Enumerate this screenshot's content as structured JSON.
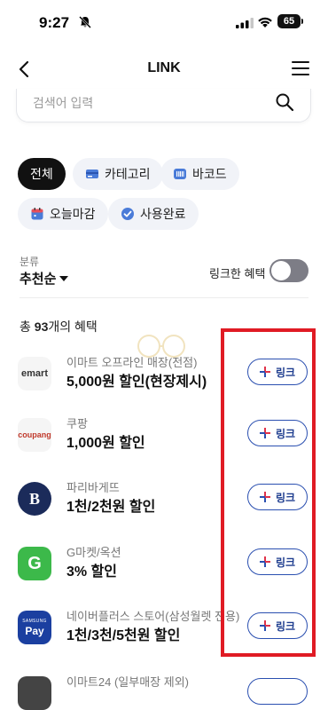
{
  "status_bar": {
    "time": "9:27",
    "battery": "65"
  },
  "header": {
    "title": "LINK"
  },
  "search": {
    "placeholder": "검색어 입력"
  },
  "filters": [
    {
      "label": "전체",
      "icon": "none",
      "active": true
    },
    {
      "label": "카테고리",
      "icon": "card-icon",
      "active": false
    },
    {
      "label": "바코드",
      "icon": "barcode-icon",
      "active": false
    },
    {
      "label": "오늘마감",
      "icon": "calendar-icon",
      "active": false
    },
    {
      "label": "사용완료",
      "icon": "check-circle-icon",
      "active": false
    }
  ],
  "sort": {
    "caption": "분류",
    "value": "추천순"
  },
  "linked_toggle": {
    "label": "링크한 혜택",
    "on": false
  },
  "summary": {
    "prefix": "총 ",
    "count": "93",
    "suffix": "개의 혜택"
  },
  "link_label": "링크",
  "items": [
    {
      "brand": "이마트 오프라인 매장(전점)",
      "benefit": "5,000원 할인(현장제시)",
      "logo_text": "emart"
    },
    {
      "brand": "쿠팡",
      "benefit": "1,000원 할인",
      "logo_text": "coupang"
    },
    {
      "brand": "파리바게뜨",
      "benefit": "1천/2천원 할인",
      "logo_text": "B"
    },
    {
      "brand": "G마켓/옥션",
      "benefit": "3% 할인",
      "logo_text": "G"
    },
    {
      "brand": "네이버플러스 스토어(삼성월렛 전용)",
      "benefit": "1천/3천/5천원 할인",
      "logo_text": "Pay",
      "logo_subtext": "SAMSUNG"
    },
    {
      "brand": "이마트24 (일부매장 제외)",
      "benefit": "",
      "logo_text": ""
    }
  ],
  "colors": {
    "accent_blue": "#1e3d8f",
    "highlight_red": "#e01b24",
    "chip_bg": "#f1f3f8"
  }
}
